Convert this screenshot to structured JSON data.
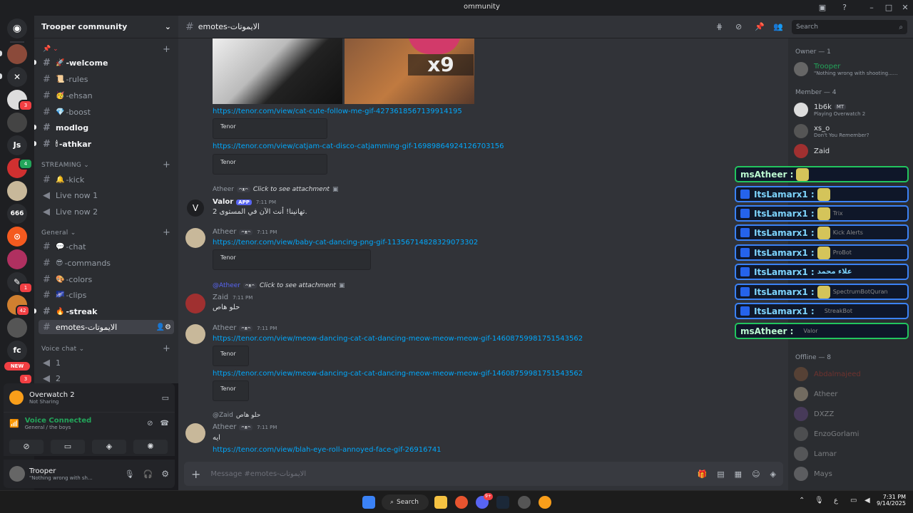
{
  "window": {
    "title": "Trooper community",
    "titlebar_partial": "ommunity"
  },
  "colors": {
    "accent": "#5865f2",
    "link": "#00a8fc",
    "green": "#23a55a",
    "toast_blue": "#3b82f6",
    "toast_green": "#22c55e"
  },
  "servers": {
    "js_label": "Js",
    "fc_label": "fc",
    "new_label": "NEW",
    "badges": [
      "3",
      "4",
      "1",
      "42",
      "3"
    ]
  },
  "guild": {
    "name": "Trooper community"
  },
  "channels": {
    "top": [
      {
        "name": "-welcome",
        "emoji": "🚀"
      },
      {
        "name": "-rules",
        "emoji": "📜"
      },
      {
        "name": "-ehsan",
        "emoji": "🥳"
      },
      {
        "name": "-boost",
        "emoji": "💎"
      },
      {
        "name": "modlog",
        "emoji": ""
      },
      {
        "name": "-athkar",
        "emoji": "🕯"
      }
    ],
    "streaming_category": "STREAMING",
    "streaming": [
      {
        "name": "-kick",
        "emoji": "🔔"
      },
      {
        "name": "Live now 1",
        "emoji": ""
      },
      {
        "name": "Live now 2",
        "emoji": ""
      }
    ],
    "general_category": "General",
    "general": [
      {
        "name": "-chat",
        "emoji": "💬"
      },
      {
        "name": "-commands",
        "emoji": "😎"
      },
      {
        "name": "-colors",
        "emoji": "🎨"
      },
      {
        "name": "-clips",
        "emoji": "🌌"
      },
      {
        "name": "-streak",
        "emoji": "🔥"
      },
      {
        "name": "emotes-الايموتات",
        "emoji": ""
      }
    ],
    "voice_category": "Voice chat",
    "voice": [
      {
        "name": "1"
      },
      {
        "name": "2"
      }
    ]
  },
  "activity": {
    "game": "Overwatch 2",
    "status": "Not Sharing"
  },
  "voice": {
    "status": "Voice Connected",
    "location": "General / the boys"
  },
  "user": {
    "name": "Trooper",
    "status": "\"Nothing wrong with sh..."
  },
  "chat_header": {
    "channel": "emotes-الايموتات",
    "search_placeholder": "Search"
  },
  "messages": {
    "overlay_badge": "x9",
    "link1": "https://tenor.com/view/cat-cute-follow-me-gif-4273618567139914195",
    "link2": "https://tenor.com/view/catjam-cat-disco-catjamming-gif-16989864924126703156",
    "tenor": "Tenor",
    "reply1": {
      "name": "Atheer",
      "action": "Click to see attachment"
    },
    "valor": {
      "name": "Valor",
      "tag": "APP",
      "time": "7:11 PM",
      "text": "تهانينا! أنت الآن في المستوى 2."
    },
    "atheer1": {
      "name": "Atheer",
      "time": "7:11 PM",
      "link": "https://tenor.com/view/baby-cat-dancing-png-gif-11356714828329073302"
    },
    "reply2": {
      "name": "@Atheer",
      "action": "Click to see attachment"
    },
    "zaid": {
      "name": "Zaid",
      "time": "7:11 PM",
      "text": "حلو هاص"
    },
    "atheer2": {
      "name": "Atheer",
      "time": "7:11 PM",
      "link1": "https://tenor.com/view/meow-dancing-cat-cat-dancing-meow-meow-meow-gif-14608759981751543562",
      "link2": "https://tenor.com/view/meow-dancing-cat-cat-dancing-meow-meow-meow-gif-14608759981751543562"
    },
    "reply3": {
      "name": "@Zaid",
      "text": "حلو هاص"
    },
    "atheer3": {
      "name": "Atheer",
      "time": "7:11 PM",
      "text": "ايه",
      "link": "https://tenor.com/view/blah-eye-roll-annoyed-face-gif-26916741"
    },
    "role_badge": "ᴖᴥᴖ"
  },
  "composer": {
    "placeholder": "Message #emotes-الايموتات"
  },
  "members": {
    "owner_header": "Owner — 1",
    "owner": [
      {
        "name": "Trooper",
        "sub": "\"Nothing wrong with shooting......",
        "color": "#23a55a"
      }
    ],
    "member_header": "Member — 4",
    "members": [
      {
        "name": "1b6k",
        "sub": "Playing Overwatch 2",
        "tag": "MT",
        "color": "#dbdee1"
      },
      {
        "name": "xs_o",
        "sub": "Don't You Remember?",
        "color": "#dbdee1"
      },
      {
        "name": "Zaid",
        "sub": "",
        "color": "#dbdee1"
      }
    ],
    "offline_header": "Offline — 8",
    "offline": [
      {
        "name": "Abdalmajeed",
        "color": "#c0392b"
      },
      {
        "name": "Atheer",
        "color": "#949ba4"
      },
      {
        "name": "DXZZ",
        "color": "#949ba4"
      },
      {
        "name": "EnzoGorlami",
        "color": "#949ba4"
      },
      {
        "name": "Lamar",
        "color": "#949ba4"
      },
      {
        "name": "Mays",
        "color": "#949ba4"
      }
    ],
    "hidden_bots": [
      "Trix",
      "Kick Alerts",
      "ProBot",
      "SpectrumBotQuran",
      "StreakBot",
      "Valor"
    ]
  },
  "toasts": [
    {
      "user": "msAtheer :",
      "style": "green"
    },
    {
      "user": "ItsLamarx1 :",
      "style": "blue"
    },
    {
      "user": "ItsLamarx1 :",
      "style": "blue"
    },
    {
      "user": "ItsLamarx1 :",
      "style": "blue"
    },
    {
      "user": "ItsLamarx1 :",
      "style": "blue"
    },
    {
      "user": "ItsLamarx1 :",
      "style": "blue",
      "extra": "علاء محمد"
    },
    {
      "user": "ItsLamarx1 :",
      "style": "blue"
    },
    {
      "user": "ItsLamarx1 :",
      "style": "blue"
    },
    {
      "user": "msAtheer :",
      "style": "green"
    }
  ],
  "taskbar": {
    "search": "Search",
    "time": "7:31 PM",
    "date": "9/14/2025",
    "lang": "ع",
    "badge": "9+"
  }
}
